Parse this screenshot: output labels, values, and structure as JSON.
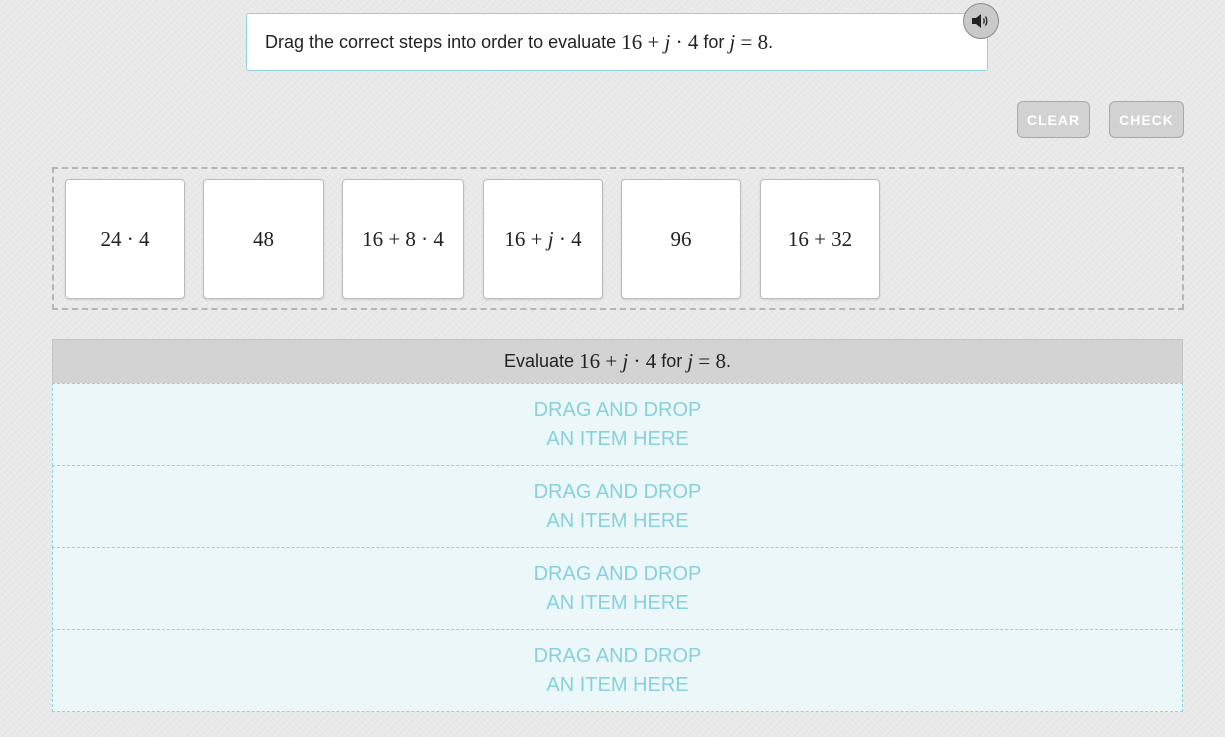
{
  "prompt": {
    "text_before": "Drag the correct steps into order to evaluate ",
    "expr": [
      "16 + ",
      "j",
      " · 4"
    ],
    "text_mid": " for ",
    "cond": [
      "j",
      " = 8"
    ],
    "text_end": "."
  },
  "audio_icon": "speaker-icon",
  "buttons": {
    "clear": "CLEAR",
    "check": "CHECK"
  },
  "cards": [
    [
      "24 · 4"
    ],
    [
      "48"
    ],
    [
      "16 + 8 · 4"
    ],
    [
      "16 + ",
      "j",
      " · 4"
    ],
    [
      "96"
    ],
    [
      "16 + 32"
    ]
  ],
  "target": {
    "header_before": "Evaluate ",
    "header_expr": [
      "16 + ",
      "j",
      " · 4"
    ],
    "header_mid": " for ",
    "header_cond": [
      "j",
      " = 8"
    ],
    "header_end": ".",
    "slots": [
      {
        "line1": "DRAG AND DROP",
        "line2": "AN ITEM HERE"
      },
      {
        "line1": "DRAG AND DROP",
        "line2": "AN ITEM HERE"
      },
      {
        "line1": "DRAG AND DROP",
        "line2": "AN ITEM HERE"
      },
      {
        "line1": "DRAG AND DROP",
        "line2": "AN ITEM HERE"
      }
    ]
  },
  "colors": {
    "accent": "#8fd3dc",
    "slot_text": "#86d1dd",
    "button": "#d2d2d2"
  }
}
